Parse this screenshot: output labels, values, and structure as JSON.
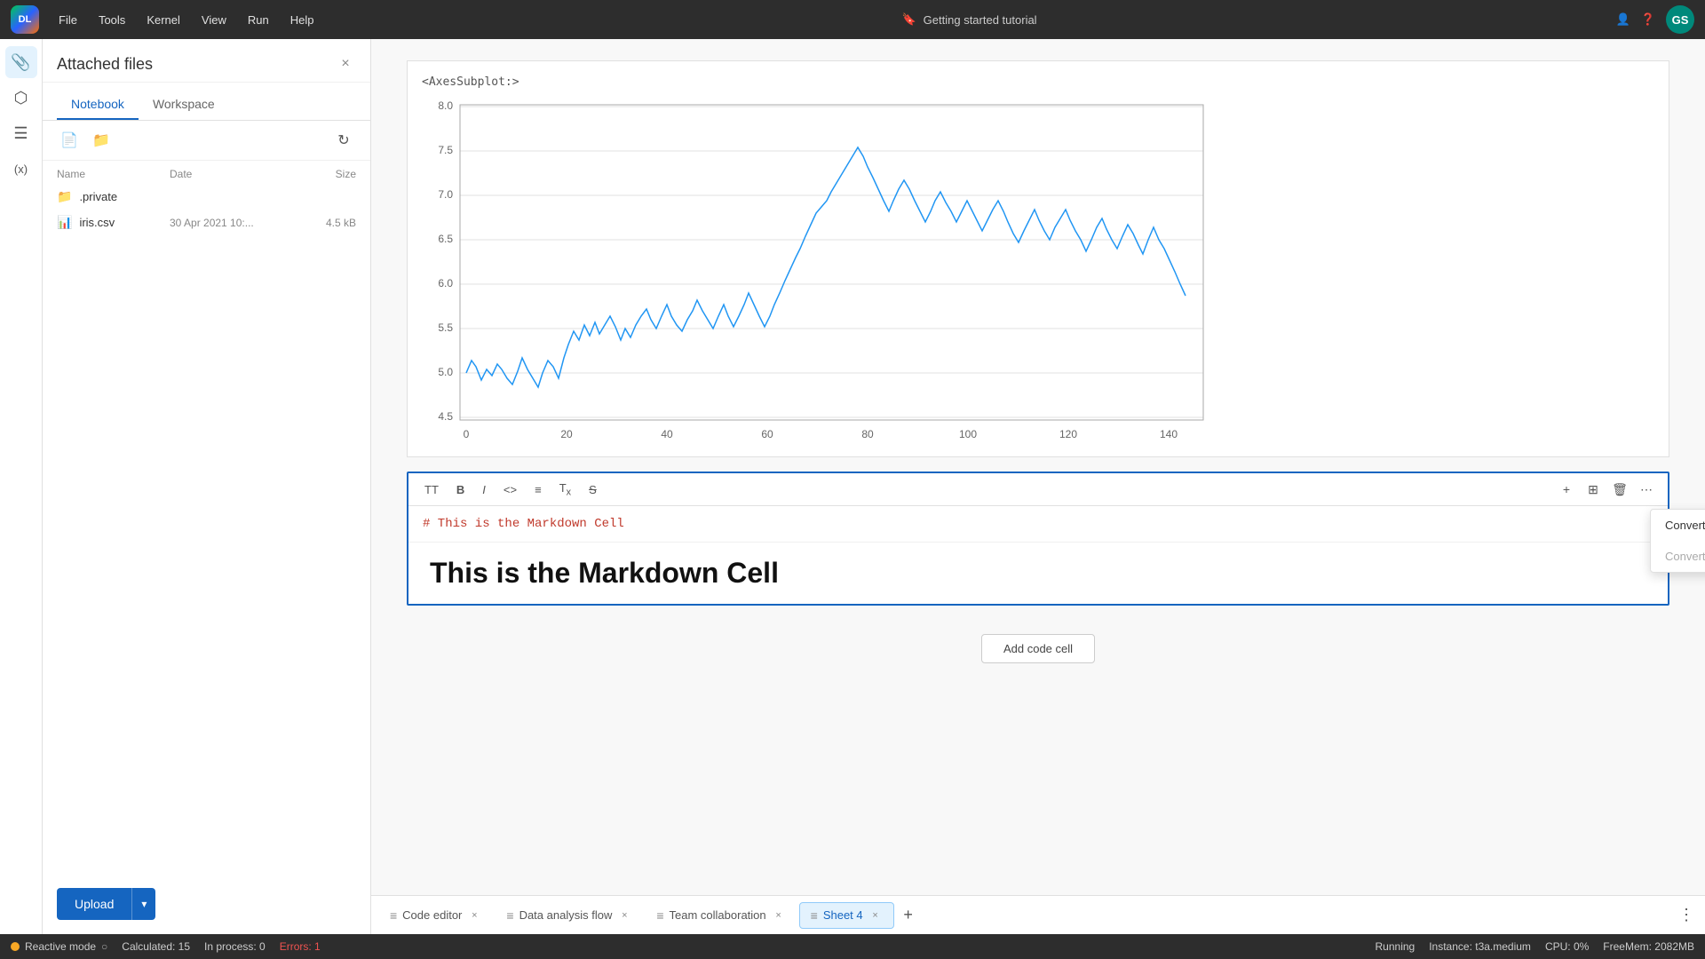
{
  "app": {
    "logo_text": "DL",
    "title": "Getting started tutorial",
    "bookmark_icon": "bookmark-icon"
  },
  "menubar": {
    "items": [
      "File",
      "Tools",
      "Kernel",
      "View",
      "Run",
      "Help"
    ],
    "right_icons": [
      "person-icon",
      "help-icon"
    ],
    "avatar_initials": "GS"
  },
  "sidebar_icons": [
    {
      "name": "paperclip-icon",
      "symbol": "📎",
      "active": true
    },
    {
      "name": "box-icon",
      "symbol": "⬡"
    },
    {
      "name": "list-icon",
      "symbol": "☰"
    },
    {
      "name": "variables-icon",
      "symbol": "(x)"
    }
  ],
  "files_panel": {
    "title": "Attached files",
    "close_label": "×",
    "tabs": [
      {
        "label": "Notebook",
        "active": true
      },
      {
        "label": "Workspace",
        "active": false
      }
    ],
    "toolbar": {
      "new_file_icon": "new-file-icon",
      "new_folder_icon": "new-folder-icon",
      "refresh_icon": "refresh-icon"
    },
    "table_headers": {
      "name": "Name",
      "date": "Date",
      "size": "Size"
    },
    "files": [
      {
        "icon": "folder-icon",
        "name": ".private",
        "date": "",
        "size": "",
        "type": "folder"
      },
      {
        "icon": "csv-icon",
        "name": "iris.csv",
        "date": "30 Apr 2021 10:...",
        "size": "4.5 kB",
        "type": "csv"
      }
    ],
    "upload_label": "Upload",
    "upload_arrow": "▾"
  },
  "notebook": {
    "axes_label": "<AxesSubplot:>",
    "chart": {
      "y_min": 4.5,
      "y_max": 8.0,
      "x_min": 0,
      "x_max": 150,
      "y_ticks": [
        4.5,
        5.0,
        5.5,
        6.0,
        6.5,
        7.0,
        7.5,
        8.0
      ],
      "x_ticks": [
        0,
        20,
        40,
        60,
        80,
        100,
        120,
        140
      ]
    },
    "markdown_cell": {
      "toolbar_buttons": [
        "TT",
        "B",
        "I",
        "<>",
        "≡",
        "Tx",
        "S̶"
      ],
      "right_buttons": [
        "+",
        "⊞",
        "🗑",
        "⋯"
      ],
      "code_content": "# This is the Markdown Cell",
      "rendered_content": "This is the Markdown Cell"
    },
    "context_menu": {
      "items": [
        {
          "label": "Convert to code",
          "disabled": false
        },
        {
          "label": "Convert to markdown",
          "disabled": true
        }
      ]
    },
    "add_cell_button": "Add code cell"
  },
  "bottom_tabs": [
    {
      "label": "Code editor",
      "icon": "≡",
      "closable": true,
      "active": false
    },
    {
      "label": "Data analysis flow",
      "icon": "≡",
      "closable": true,
      "active": false
    },
    {
      "label": "Team collaboration",
      "icon": "≡",
      "closable": true,
      "active": false
    },
    {
      "label": "Sheet 4",
      "icon": "≡",
      "closable": true,
      "active": true
    }
  ],
  "status_bar": {
    "reactive_mode": "Reactive mode",
    "dot_icon": "status-dot-icon",
    "circle_icon": "○",
    "calculated": "Calculated: 15",
    "in_process": "In process: 0",
    "errors": "Errors: 1",
    "right": {
      "running": "Running",
      "instance": "Instance: t3a.medium",
      "cpu": "CPU: 0%",
      "free_mem": "FreeMem: 2082MB"
    }
  }
}
